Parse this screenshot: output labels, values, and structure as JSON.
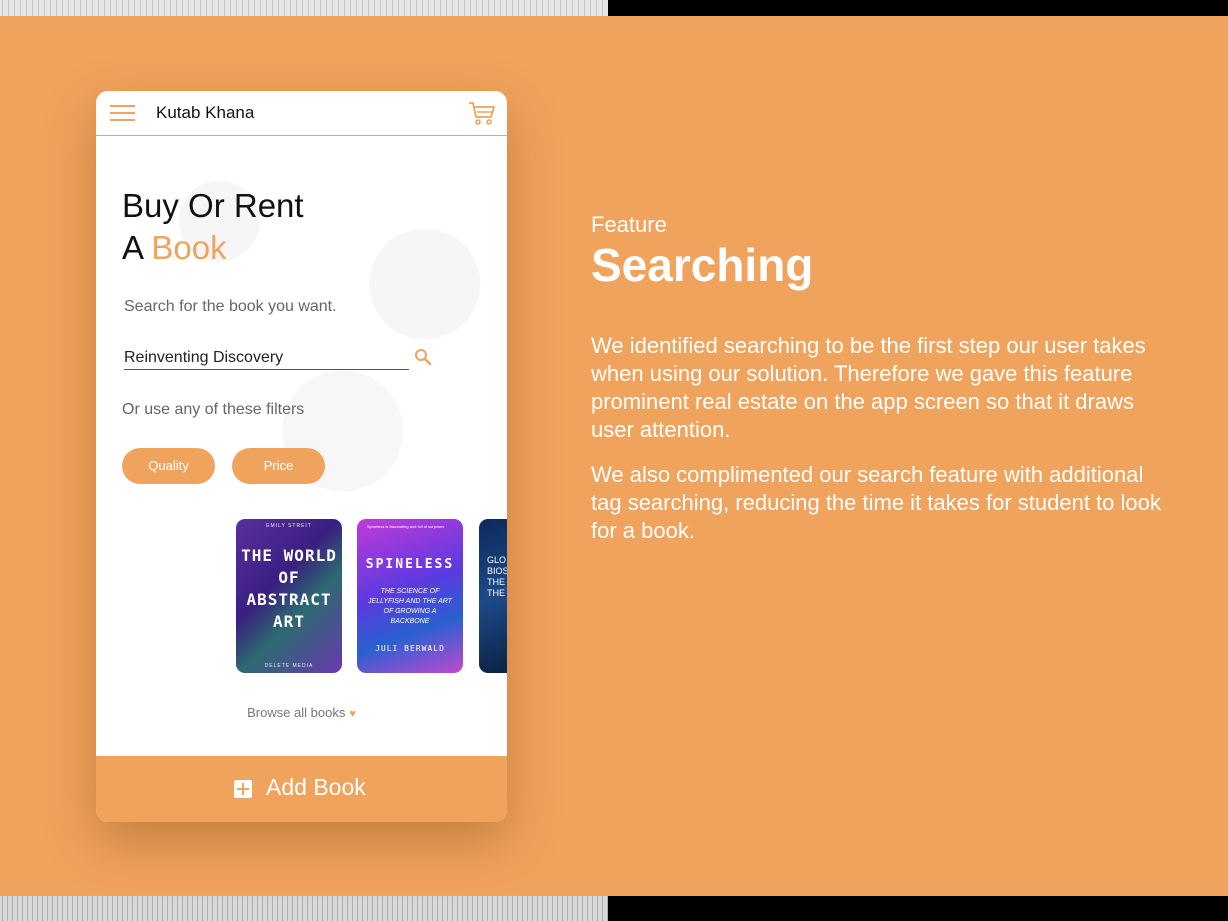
{
  "app": {
    "title": "Kutab Khana"
  },
  "hero": {
    "line1": "Buy Or Rent",
    "line2_prefix": "A ",
    "line2_accent": "Book"
  },
  "search": {
    "hint": "Search for the book you want.",
    "value": "Reinventing Discovery"
  },
  "filters": {
    "hint": "Or use any of these filters",
    "chips": [
      "Quality",
      "Price"
    ]
  },
  "books": [
    {
      "top_text": "EMILY STREIT",
      "title": "THE WORLD OF ABSTRACT ART",
      "bottom_text": "DELETE MEDIA"
    },
    {
      "top_text": "Spineless is fascinating and full of surprises",
      "title": "SPINELESS",
      "subtitle": "THE SCIENCE OF JELLYFISH AND THE ART OF GROWING A BACKBONE",
      "author": "JULI BERWALD"
    },
    {
      "title": "GLO BIOS THE THE"
    }
  ],
  "browse": {
    "label": "Browse all books"
  },
  "add_book": {
    "label": "Add Book"
  },
  "feature": {
    "label": "Feature",
    "title": "Searching",
    "paragraph1": "We identified searching to be the first step our user takes when using our solution. Therefore we gave this feature prominent real estate on the app screen so that it draws user attention.",
    "paragraph2": "We also complimented our search feature with additional tag searching, reducing the time it takes for student to look for a book."
  },
  "colors": {
    "accent": "#F0A35D",
    "text": "#111111"
  },
  "icons": [
    "menu-icon",
    "cart-icon",
    "search-icon",
    "heart-icon",
    "plus-icon"
  ]
}
